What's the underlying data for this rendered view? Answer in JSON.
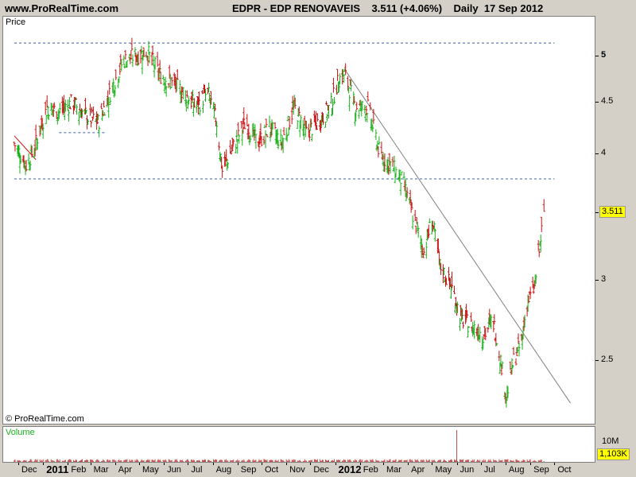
{
  "header": {
    "site": "www.ProRealTime.com",
    "title": "EDPR - EDP RENOVAVEIS    3.511 (+4.06%)    Daily  17 Sep 2012"
  },
  "price_panel": {
    "label": "Price",
    "copyright": "© ProRealTime.com",
    "last_price": "3.511"
  },
  "volume_panel": {
    "label": "Volume",
    "scale_label": "10M",
    "last_volume": "1,103K"
  },
  "colors": {
    "up": "#19b219",
    "down": "#cc1111",
    "guide": "#3f5fa8",
    "trend": "#808080",
    "volume": "#c0504d"
  },
  "chart_data": {
    "type": "ohlc",
    "title": "EDPR - EDP RENOVAVEIS",
    "ylim": [
      2.3,
      5.2
    ],
    "yticks": [
      2.5,
      3,
      3.5,
      4,
      4.5,
      5
    ],
    "ytick_labels": [
      "2.5",
      "3",
      "",
      "4",
      "4.5",
      "5"
    ],
    "x_labels": [
      "Dec",
      "2011",
      "Feb",
      "Mar",
      "Apr",
      "May",
      "Jun",
      "Jul",
      "Aug",
      "Sep",
      "Oct",
      "Nov",
      "Dec",
      "2012",
      "Feb",
      "Mar",
      "Apr",
      "May",
      "Jun",
      "Jul",
      "Aug",
      "Sep",
      "Oct"
    ],
    "months": [
      "2010-12",
      "2011-01",
      "2011-02",
      "2011-03",
      "2011-04",
      "2011-05",
      "2011-06",
      "2011-07",
      "2011-08",
      "2011-09",
      "2011-10",
      "2011-11",
      "2011-12",
      "2012-01",
      "2012-02",
      "2012-03",
      "2012-04",
      "2012-05",
      "2012-06",
      "2012-07",
      "2012-08",
      "2012-09",
      "2012-10"
    ],
    "price_path": [
      {
        "date": "2010-11-25",
        "close": 4.1
      },
      {
        "date": "2010-12-10",
        "close": 3.9
      },
      {
        "date": "2010-12-20",
        "close": 4.05
      },
      {
        "date": "2011-01-05",
        "close": 4.45
      },
      {
        "date": "2011-01-20",
        "close": 4.4
      },
      {
        "date": "2011-02-05",
        "close": 4.5
      },
      {
        "date": "2011-02-25",
        "close": 4.35
      },
      {
        "date": "2011-03-10",
        "close": 4.3
      },
      {
        "date": "2011-03-25",
        "close": 4.6
      },
      {
        "date": "2011-04-10",
        "close": 4.95
      },
      {
        "date": "2011-04-25",
        "close": 5.0
      },
      {
        "date": "2011-05-10",
        "close": 5.05
      },
      {
        "date": "2011-05-25",
        "close": 4.8
      },
      {
        "date": "2011-06-10",
        "close": 4.7
      },
      {
        "date": "2011-06-25",
        "close": 4.6
      },
      {
        "date": "2011-07-10",
        "close": 4.45
      },
      {
        "date": "2011-07-25",
        "close": 4.6
      },
      {
        "date": "2011-08-05",
        "close": 4.3
      },
      {
        "date": "2011-08-12",
        "close": 3.85
      },
      {
        "date": "2011-08-25",
        "close": 4.05
      },
      {
        "date": "2011-09-10",
        "close": 4.3
      },
      {
        "date": "2011-09-25",
        "close": 4.1
      },
      {
        "date": "2011-10-10",
        "close": 4.25
      },
      {
        "date": "2011-10-25",
        "close": 4.1
      },
      {
        "date": "2011-11-10",
        "close": 4.45
      },
      {
        "date": "2011-11-25",
        "close": 4.2
      },
      {
        "date": "2011-12-10",
        "close": 4.3
      },
      {
        "date": "2011-12-25",
        "close": 4.45
      },
      {
        "date": "2012-01-05",
        "close": 4.75
      },
      {
        "date": "2012-01-12",
        "close": 4.8
      },
      {
        "date": "2012-01-25",
        "close": 4.45
      },
      {
        "date": "2012-02-10",
        "close": 4.45
      },
      {
        "date": "2012-02-25",
        "close": 4.0
      },
      {
        "date": "2012-03-10",
        "close": 3.9
      },
      {
        "date": "2012-03-25",
        "close": 3.75
      },
      {
        "date": "2012-04-05",
        "close": 3.5
      },
      {
        "date": "2012-04-20",
        "close": 3.2
      },
      {
        "date": "2012-04-30",
        "close": 3.45
      },
      {
        "date": "2012-05-10",
        "close": 3.1
      },
      {
        "date": "2012-05-25",
        "close": 2.95
      },
      {
        "date": "2012-06-05",
        "close": 2.75
      },
      {
        "date": "2012-06-20",
        "close": 2.7
      },
      {
        "date": "2012-07-05",
        "close": 2.65
      },
      {
        "date": "2012-07-15",
        "close": 2.75
      },
      {
        "date": "2012-07-25",
        "close": 2.5
      },
      {
        "date": "2012-08-01",
        "close": 2.3
      },
      {
        "date": "2012-08-10",
        "close": 2.5
      },
      {
        "date": "2012-08-20",
        "close": 2.6
      },
      {
        "date": "2012-08-27",
        "close": 2.85
      },
      {
        "date": "2012-09-05",
        "close": 2.95
      },
      {
        "date": "2012-09-12",
        "close": 3.25
      },
      {
        "date": "2012-09-17",
        "close": 3.511
      }
    ],
    "guide_levels": [
      {
        "from": "2010-11-25",
        "to": "2012-09-30",
        "price": 5.15
      },
      {
        "from": "2010-11-25",
        "to": "2012-09-30",
        "price": 3.78
      },
      {
        "from": "2011-01-20",
        "to": "2011-03-20",
        "price": 4.2
      }
    ],
    "trendlines": [
      {
        "date1": "2010-11-25",
        "price1": 4.17,
        "date2": "2010-12-22",
        "price2": 3.95,
        "color": "down"
      },
      {
        "date1": "2012-01-12",
        "price1": 4.85,
        "date2": "2012-10-20",
        "price2": 2.27,
        "color": "trend"
      }
    ],
    "volume_spike": {
      "date": "2012-05-31"
    }
  }
}
